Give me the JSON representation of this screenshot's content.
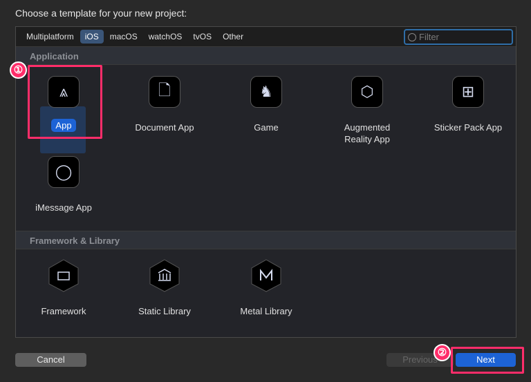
{
  "title": "Choose a template for your new project:",
  "tabs": [
    "Multiplatform",
    "iOS",
    "macOS",
    "watchOS",
    "tvOS",
    "Other"
  ],
  "selected_tab": "iOS",
  "filter": {
    "placeholder": "Filter"
  },
  "sections": [
    {
      "header": "Application",
      "items": [
        "App",
        "Document App",
        "Game",
        "Augmented Reality App",
        "Sticker Pack App",
        "iMessage App"
      ]
    },
    {
      "header": "Framework & Library",
      "items": [
        "Framework",
        "Static Library",
        "Metal Library"
      ]
    }
  ],
  "selected_item": "App",
  "buttons": {
    "cancel": "Cancel",
    "previous": "Previous",
    "next": "Next"
  },
  "annotations": [
    "①",
    "②"
  ],
  "colors": {
    "accent": "#1d63d6",
    "annotation": "#ff2d6a"
  }
}
